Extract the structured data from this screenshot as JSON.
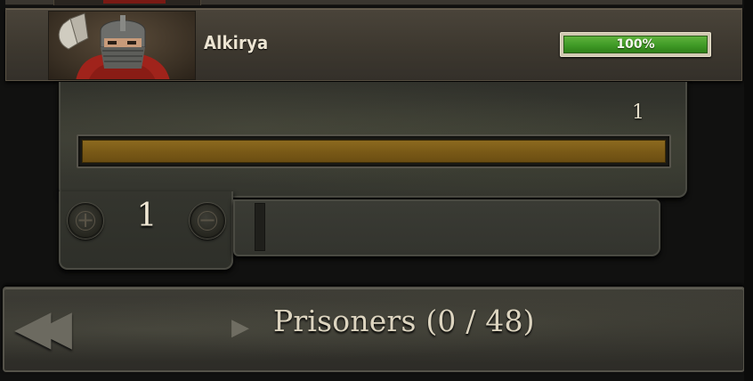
{
  "troop": {
    "name": "Alkirya",
    "health_text": "100%",
    "health": 1.0
  },
  "transfer": {
    "max_count_label": "1",
    "fill_fraction": 1.0,
    "amount": "1",
    "plus_icon": "plus-circle-icon",
    "minus_icon": "minus-circle-icon"
  },
  "footer": {
    "rewind_icon": "double-chevron-left-icon",
    "expand_icon": "play-triangle-icon",
    "prisoners_label": "Prisoners (0 / 48)"
  },
  "colors": {
    "health_green": "#3f9a26",
    "count_gold": "#7a5a17",
    "text_light": "#ece4d2"
  }
}
